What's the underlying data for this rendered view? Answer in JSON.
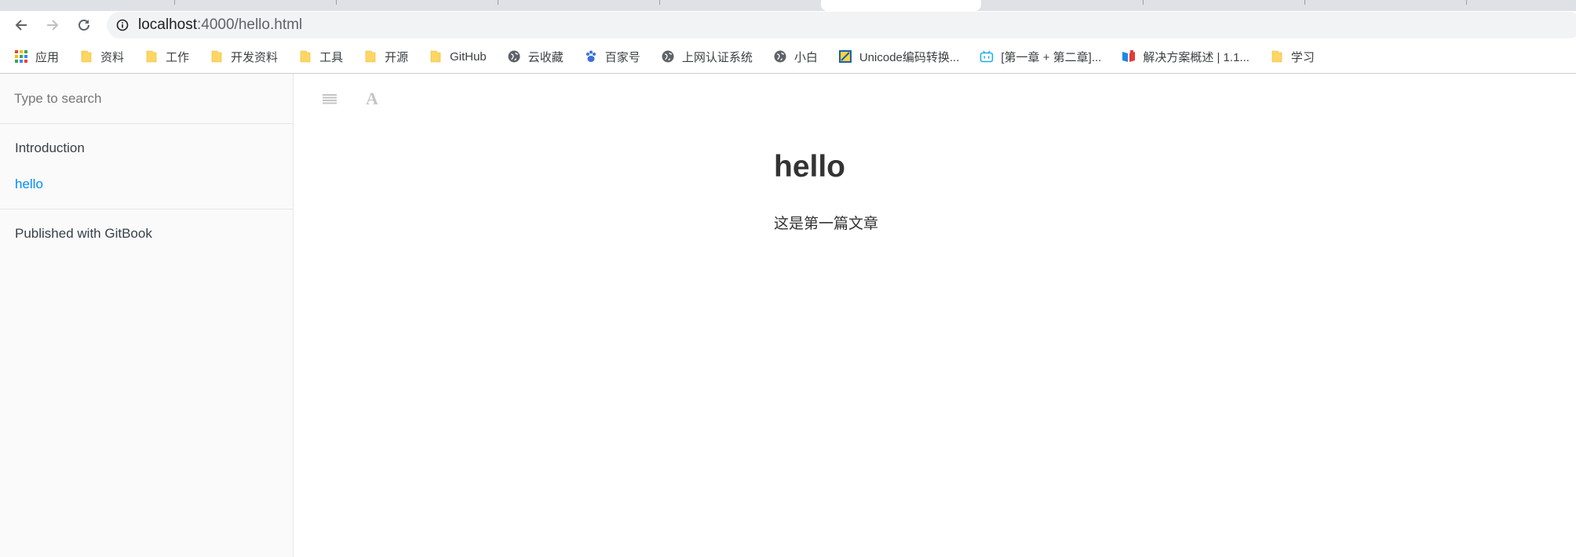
{
  "browser": {
    "url_host": "localhost",
    "url_path": ":4000/hello.html",
    "bookmarks": [
      {
        "label": "应用",
        "icon": "apps-grid-icon"
      },
      {
        "label": "资料",
        "icon": "folder-icon"
      },
      {
        "label": "工作",
        "icon": "folder-icon"
      },
      {
        "label": "开发资料",
        "icon": "folder-icon"
      },
      {
        "label": "工具",
        "icon": "folder-icon"
      },
      {
        "label": "开源",
        "icon": "folder-icon"
      },
      {
        "label": "GitHub",
        "icon": "folder-icon"
      },
      {
        "label": "云收藏",
        "icon": "globe-icon"
      },
      {
        "label": "百家号",
        "icon": "paw-icon"
      },
      {
        "label": "上网认证系统",
        "icon": "globe-icon"
      },
      {
        "label": "小白",
        "icon": "globe-icon"
      },
      {
        "label": "Unicode编码转换...",
        "icon": "unicode-icon"
      },
      {
        "label": "[第一章 + 第二章]...",
        "icon": "bilibili-icon"
      },
      {
        "label": "解决方案概述 | 1.1...",
        "icon": "book-icon"
      },
      {
        "label": "学习",
        "icon": "folder-icon"
      }
    ]
  },
  "sidebar": {
    "search_placeholder": "Type to search",
    "items": [
      {
        "label": "Introduction",
        "active": false
      },
      {
        "label": "hello",
        "active": true
      }
    ],
    "published": "Published with GitBook"
  },
  "header": {
    "toggle_icon": "menu-lines-icon",
    "font_icon": "font-settings-icon",
    "font_glyph": "A"
  },
  "article": {
    "title": "hello",
    "body": "这是第一篇文章"
  },
  "colors": {
    "folder": "#fdd663",
    "active_link": "#008cff",
    "text": "#333333"
  }
}
